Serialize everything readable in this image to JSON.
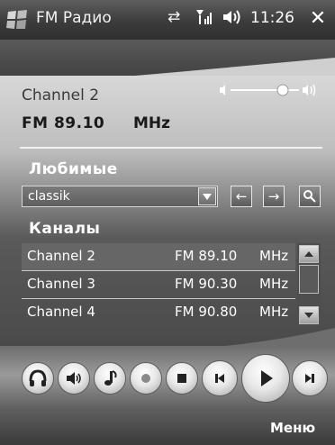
{
  "titlebar": {
    "title": "FM Радио",
    "time": "11:26",
    "icons": [
      "windows-start-icon",
      "connectivity-icon",
      "signal-icon",
      "speaker-icon",
      "close-icon"
    ]
  },
  "station": {
    "name": "Channel 2",
    "band_freq": "FM 89.10",
    "unit": "MHz"
  },
  "volume": {
    "level": 0.7
  },
  "favorites": {
    "label": "Любимые",
    "selected": "classik"
  },
  "channels": {
    "label": "Каналы",
    "rows": [
      {
        "name": "Channel 2",
        "freq": "FM 89.10",
        "unit": "MHz",
        "selected": true
      },
      {
        "name": "Channel 3",
        "freq": "FM 90.30",
        "unit": "MHz",
        "selected": false
      },
      {
        "name": "Channel 4",
        "freq": "FM 90.80",
        "unit": "MHz",
        "selected": false
      }
    ]
  },
  "controls": [
    "headphones-icon",
    "speaker-icon",
    "music-note-icon",
    "record-icon",
    "stop-icon",
    "previous-icon",
    "play-icon",
    "next-icon"
  ],
  "softkeys": {
    "right": "Меню"
  }
}
